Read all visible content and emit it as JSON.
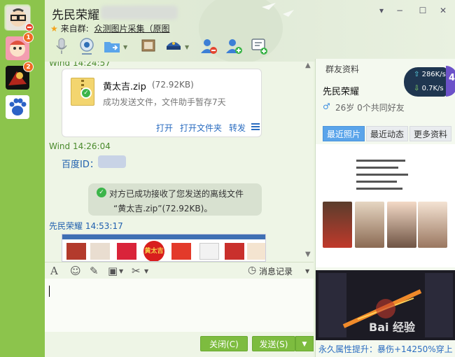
{
  "window": {
    "title": "先民荣耀",
    "subtitle_prefix": "来自群:",
    "subtitle_group": "众测图片采集（原图",
    "controls": [
      "−",
      "☐",
      "✕"
    ]
  },
  "rail": {
    "badge_1": "1",
    "badge_2": "2"
  },
  "chat": {
    "msg1_sender": "Wind  14:24:57",
    "file_name": "黄太吉.zip",
    "file_size": "(72.92KB)",
    "file_status": "成功发送文件，文件助手暂存7天",
    "action_open": "打开",
    "action_open_folder": "打开文件夹",
    "action_forward": "转发",
    "msg2_sender": "Wind  14:26:04",
    "baidu_label": "百度ID：",
    "notice_line1": "对方已成功接收了您发送的离线文件",
    "notice_line2": "“黄太吉.zip”(72.92KB)。",
    "msg3_sender": "先民荣耀  14:53:17",
    "thumb_label": "黄太吉"
  },
  "input_bar": {
    "font_icon": "A",
    "history_label": "消息记录"
  },
  "footer": {
    "close_button": "关闭(C)",
    "send_button": "发送(S)"
  },
  "panel": {
    "title": "群友资料",
    "speed_up": "286K/s",
    "speed_down": "0.7K/s",
    "speed_value": "4",
    "friend_name": "先民荣耀",
    "friend_meta": "26岁  0个共同好友",
    "tabs": [
      "最近照片",
      "最近动态",
      "更多资料"
    ],
    "watermark": "Bai 经验",
    "ad_text": "永久属性提升：暴伤+14250%穿上"
  },
  "colors": {
    "rail": "#8cc44c",
    "accent_green": "#7dbc3f",
    "link_blue": "#2a6cc0",
    "tab_active": "#5aa4ea"
  }
}
